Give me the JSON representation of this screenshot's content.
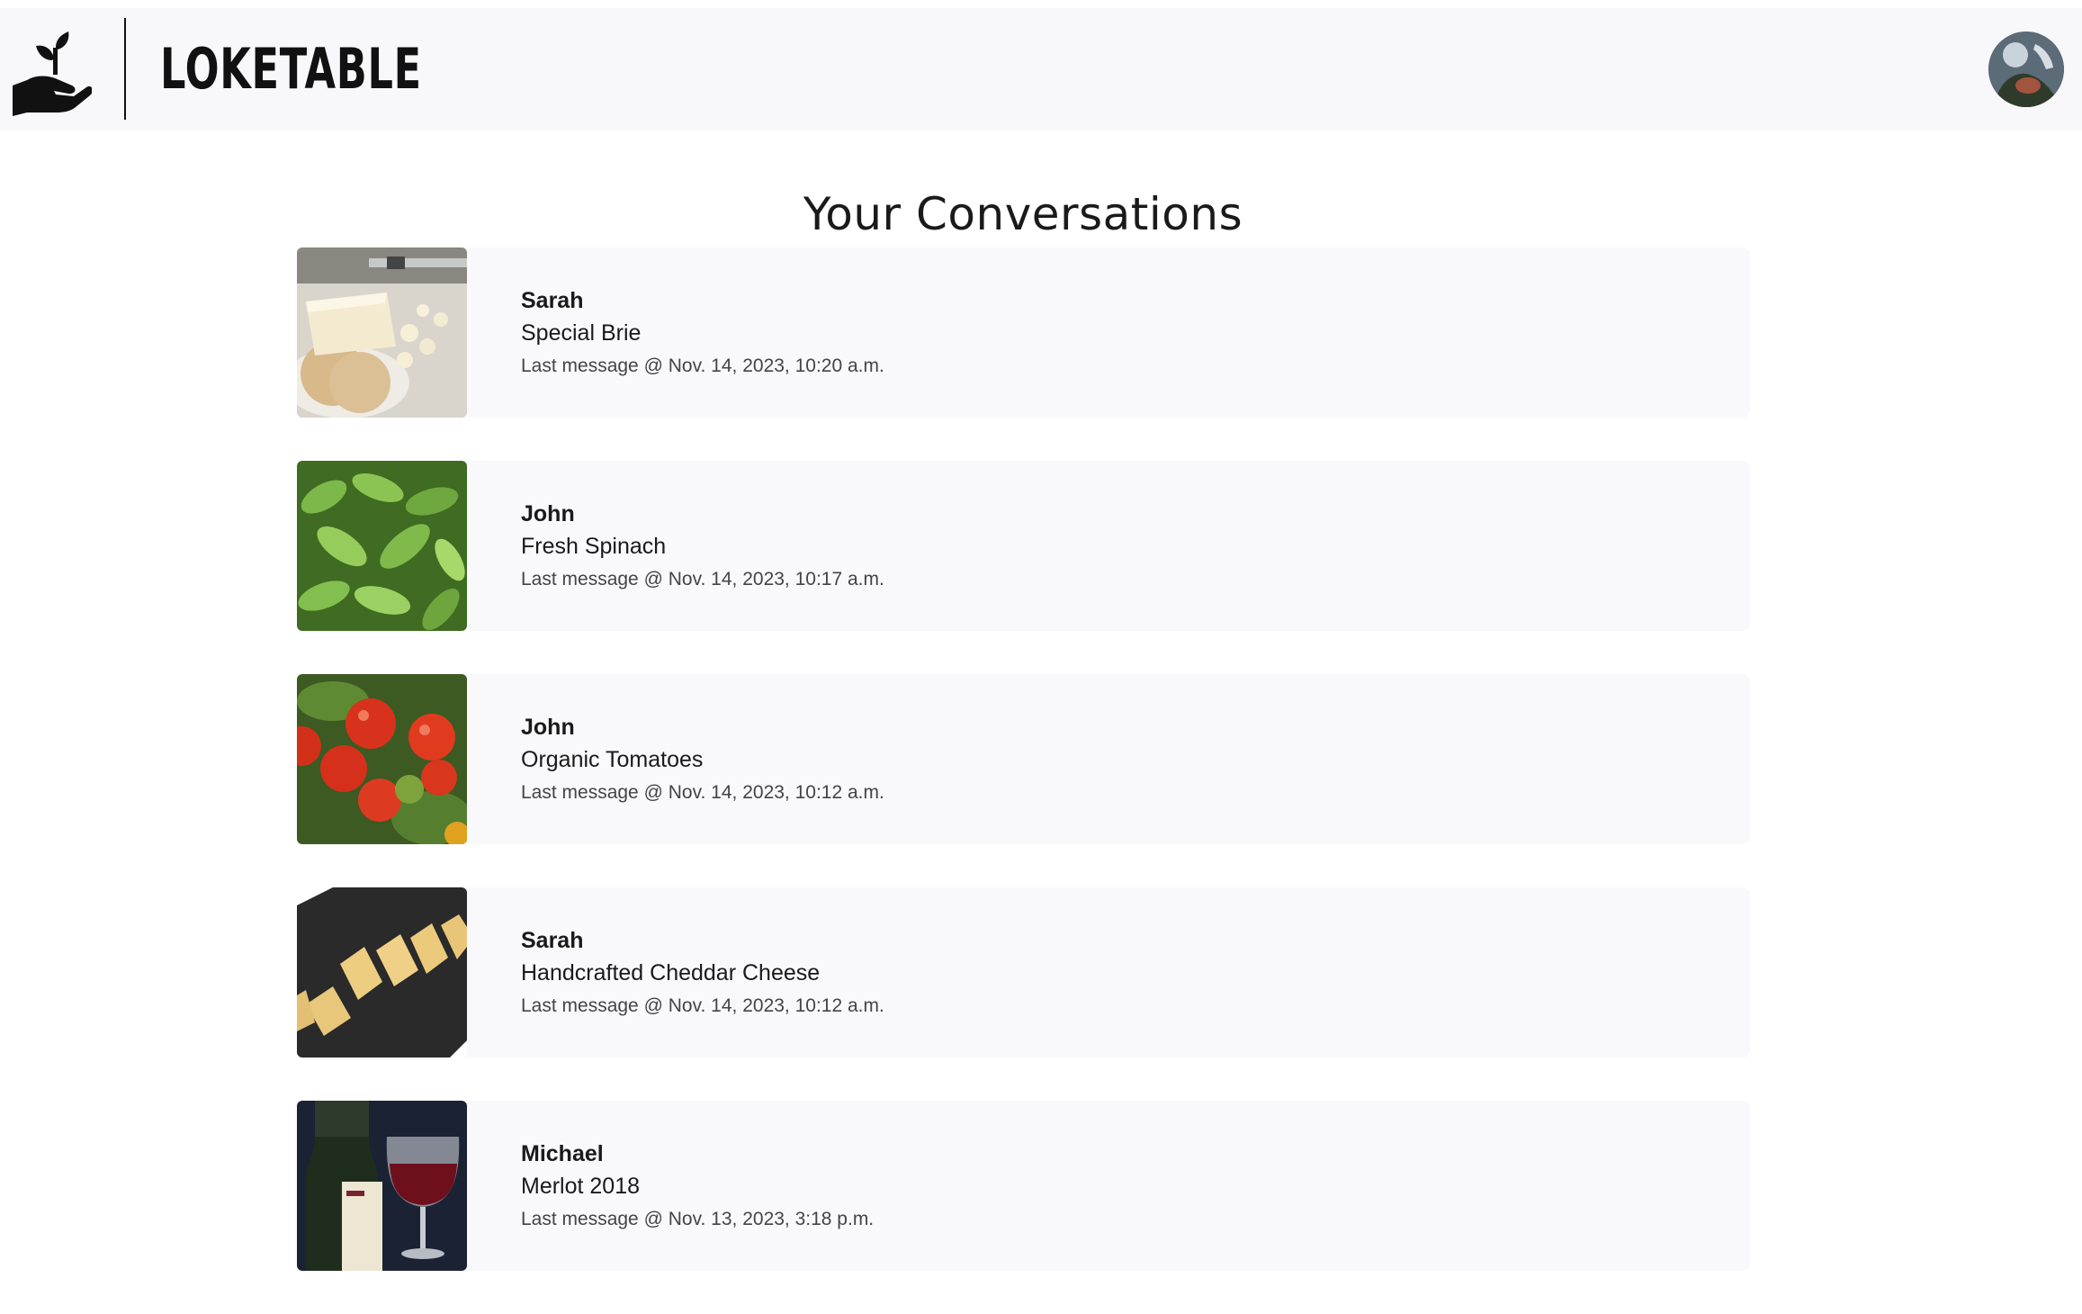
{
  "brand": {
    "name": "LOKETABLE",
    "logo_icon": "hand-sprout-icon"
  },
  "header": {
    "avatar_icon": "user-avatar"
  },
  "page": {
    "title": "Your Conversations"
  },
  "conversations": [
    {
      "name": "Sarah",
      "product": "Special Brie",
      "last_message": "Last message @ Nov. 14, 2023, 10:20 a.m.",
      "image": "brie-cheese-crackers"
    },
    {
      "name": "John",
      "product": "Fresh Spinach",
      "last_message": "Last message @ Nov. 14, 2023, 10:17 a.m.",
      "image": "spinach-leaves"
    },
    {
      "name": "John",
      "product": "Organic Tomatoes",
      "last_message": "Last message @ Nov. 14, 2023, 10:12 a.m.",
      "image": "tomatoes-on-vine"
    },
    {
      "name": "Sarah",
      "product": "Handcrafted Cheddar Cheese",
      "last_message": "Last message @ Nov. 14, 2023, 10:12 a.m.",
      "image": "cheddar-sticks-slate"
    },
    {
      "name": "Michael",
      "product": "Merlot 2018",
      "last_message": "Last message @ Nov. 13, 2023, 3:18 p.m.",
      "image": "wine-bottle-glass"
    }
  ]
}
